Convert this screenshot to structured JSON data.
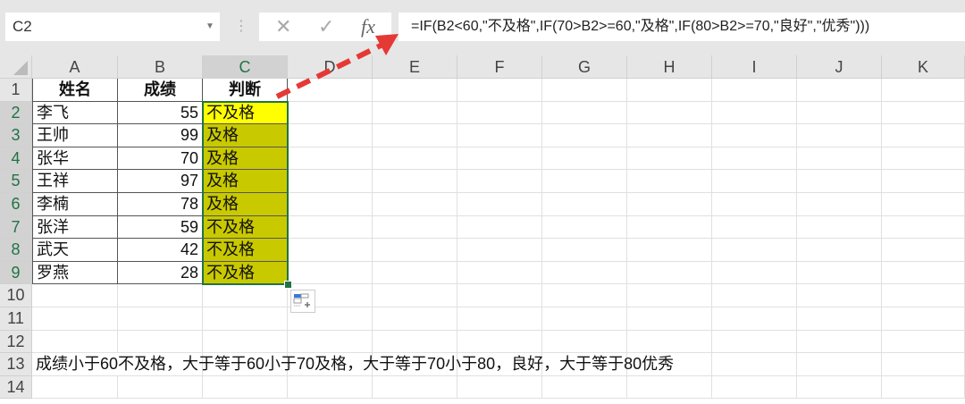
{
  "name_box": "C2",
  "formula_bar": {
    "cancel_icon": "✕",
    "enter_icon": "✓",
    "fx_label": "fx",
    "formula": "=IF(B2<60,\"不及格\",IF(70>B2>=60,\"及格\",IF(80>B2>=70,\"良好\",\"优秀\")))"
  },
  "columns": [
    "A",
    "B",
    "C",
    "D",
    "E",
    "F",
    "G",
    "H",
    "I",
    "J",
    "K"
  ],
  "rows": [
    "1",
    "2",
    "3",
    "4",
    "5",
    "6",
    "7",
    "8",
    "9",
    "10",
    "11",
    "12",
    "13",
    "14"
  ],
  "headers": [
    "姓名",
    "成绩",
    "判断"
  ],
  "table": [
    [
      "李飞",
      55,
      "不及格"
    ],
    [
      "王帅",
      99,
      "及格"
    ],
    [
      "张华",
      70,
      "及格"
    ],
    [
      "王祥",
      97,
      "及格"
    ],
    [
      "李楠",
      78,
      "及格"
    ],
    [
      "张洋",
      59,
      "不及格"
    ],
    [
      "武天",
      42,
      "不及格"
    ],
    [
      "罗燕",
      28,
      "不及格"
    ]
  ],
  "note": "成绩小于60不及格，大于等于60小于70及格，大于等于70小于80，良好，大于等于80优秀",
  "colors": {
    "active_cell": "#ffff00",
    "filled": "#c9c900",
    "arrow": "#e53935",
    "selection": "#217346"
  }
}
